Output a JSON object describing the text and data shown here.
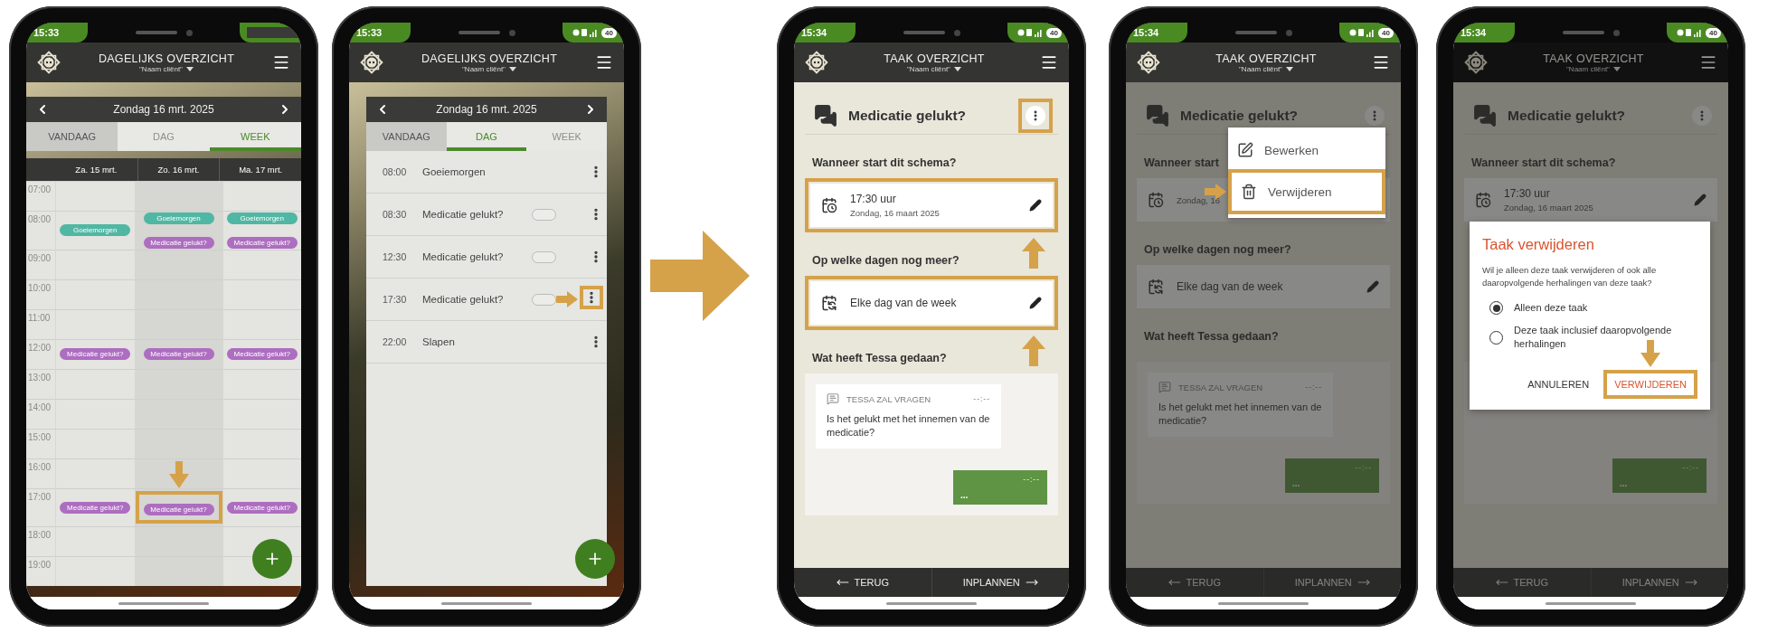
{
  "steps": [
    {
      "kind": "week",
      "status": {
        "time": "15:33",
        "redacted": true
      },
      "header": {
        "title": "DAGELIJKS OVERZICHT",
        "subtitle": "\"Naam cliënt\""
      },
      "date": "Zondag 16 mrt. 2025",
      "tabs": [
        {
          "label": "VANDAAG",
          "kind": "button",
          "selected": false
        },
        {
          "label": "DAG",
          "kind": "tab",
          "selected": false
        },
        {
          "label": "WEEK",
          "kind": "tab",
          "selected": true
        }
      ],
      "days": [
        {
          "label": "Za. 15 mrt.",
          "today": false
        },
        {
          "label": "Zo. 16 mrt.",
          "today": true
        },
        {
          "label": "Ma. 17 mrt.",
          "today": false
        }
      ],
      "hours": [
        {
          "label": "07:00"
        },
        {
          "label": "08:00",
          "cells": [
            {
              "events": [
                {
                  "label": "Goeiemorgen",
                  "color": "#4fb7a3"
                }
              ]
            },
            {
              "events": [
                {
                  "label": "Goeiemorgen",
                  "color": "#4fb7a3"
                },
                {
                  "label": "Medicatie gelukt?",
                  "color": "#ad6dc0"
                }
              ]
            },
            {
              "events": [
                {
                  "label": "Goeiemorgen",
                  "color": "#4fb7a3"
                },
                {
                  "label": "Medicatie gelukt?",
                  "color": "#ad6dc0"
                }
              ]
            }
          ]
        },
        {
          "label": "09:00"
        },
        {
          "label": "10:00"
        },
        {
          "label": "11:00"
        },
        {
          "label": "12:00",
          "cells": [
            {
              "events": [
                {
                  "label": "Medicatie gelukt?",
                  "color": "#ad6dc0"
                }
              ]
            },
            {
              "events": [
                {
                  "label": "Medicatie gelukt?",
                  "color": "#ad6dc0"
                }
              ]
            },
            {
              "events": [
                {
                  "label": "Medicatie gelukt?",
                  "color": "#ad6dc0"
                }
              ]
            }
          ]
        },
        {
          "label": "13:00"
        },
        {
          "label": "14:00"
        },
        {
          "label": "15:00"
        },
        {
          "label": "16:00"
        },
        {
          "label": "17:00",
          "cells": [
            {
              "events": [
                {
                  "label": "Medicatie gelukt?",
                  "color": "#ad6dc0"
                }
              ]
            },
            {
              "events": [
                {
                  "label": "Medicatie gelukt?",
                  "color": "#ad6dc0",
                  "highlight": {
                    "kind": "arrow-down"
                  }
                }
              ]
            },
            {
              "events": [
                {
                  "label": "Medicatie gelukt?",
                  "color": "#ad6dc0"
                }
              ]
            }
          ]
        },
        {
          "label": "18:00"
        },
        {
          "label": "19:00"
        }
      ]
    },
    {
      "kind": "day",
      "status": {
        "time": "15:33",
        "battery": "40"
      },
      "header": {
        "title": "DAGELIJKS OVERZICHT",
        "subtitle": "\"Naam cliënt\""
      },
      "date": "Zondag 16 mrt. 2025",
      "tabs": [
        {
          "label": "VANDAAG",
          "kind": "button",
          "selected": false
        },
        {
          "label": "DAG",
          "kind": "tab",
          "selected": true
        },
        {
          "label": "WEEK",
          "kind": "tab",
          "selected": false
        }
      ],
      "tasks": [
        {
          "time": "08:00",
          "label": "Goeiemorgen"
        },
        {
          "time": "08:30",
          "label": "Medicatie gelukt?",
          "toggle": {
            "on": false
          }
        },
        {
          "time": "12:30",
          "label": "Medicatie gelukt?",
          "toggle": {
            "on": false
          }
        },
        {
          "time": "17:30",
          "label": "Medicatie gelukt?",
          "toggle": {
            "on": false
          },
          "more_highlight": {
            "kind": "arrow-right"
          }
        },
        {
          "time": "22:00",
          "label": "Slapen"
        }
      ]
    },
    {
      "kind": "detail",
      "status": {
        "time": "15:34",
        "battery": "40"
      },
      "header": {
        "title": "TAAK OVERZICHT",
        "subtitle": "\"Naam cliënt\""
      },
      "task": {
        "title": "Medicatie gelukt?",
        "more_highlight": {
          "kind": "box"
        }
      },
      "sections": [
        {
          "heading": "Wanneer start dit schema?",
          "card": {
            "kind": "datetime",
            "line1": "17:30 uur",
            "line2": "Zondag, 16 maart 2025",
            "editable": true,
            "highlight": {
              "kind": "arrow-up"
            }
          }
        },
        {
          "heading": "Op welke dagen nog meer?",
          "card": {
            "kind": "repeat",
            "line1": "Elke dag van de week",
            "editable": true,
            "highlight": {
              "kind": "arrow-up"
            }
          }
        }
      ],
      "conversation": {
        "heading": "Wat heeft Tessa gedaan?",
        "question": {
          "sender": "TESSA ZAL VRAGEN",
          "time": "--:--",
          "text": "Is het gelukt met het innemen van de medicatie?"
        },
        "reply": {
          "text": "...",
          "time": "--:--"
        }
      },
      "footer": [
        {
          "label": "TERUG",
          "kind": "back"
        },
        {
          "label": "INPLANNEN",
          "kind": "next"
        }
      ]
    },
    {
      "kind": "detail",
      "dimmed": true,
      "status": {
        "time": "15:34",
        "battery": "40"
      },
      "header": {
        "title": "TAAK OVERZICHT",
        "subtitle": "\"Naam cliënt\""
      },
      "task": {
        "title": "Medicatie gelukt?"
      },
      "sections": [
        {
          "heading": "Wanneer start",
          "card": {
            "kind": "datetime",
            "line2": "Zondag, 16"
          }
        },
        {
          "heading": "Op welke dagen nog meer?",
          "card": {
            "kind": "repeat",
            "line1": "Elke dag van de week",
            "editable": true
          }
        }
      ],
      "conversation": {
        "heading": "Wat heeft Tessa gedaan?",
        "question": {
          "sender": "TESSA ZAL VRAGEN",
          "time": "--:--",
          "text": "Is het gelukt met het innemen van de medicatie?"
        },
        "reply": {
          "text": "...",
          "time": "--:--"
        }
      },
      "footer": [
        {
          "label": "TERUG",
          "kind": "back"
        },
        {
          "label": "INPLANNEN",
          "kind": "next"
        }
      ],
      "menu": {
        "items": [
          {
            "kind": "edit",
            "label": "Bewerken"
          },
          {
            "kind": "delete",
            "label": "Verwijderen",
            "highlight": {
              "kind": "arrow-right"
            }
          }
        ]
      }
    },
    {
      "kind": "detail",
      "dimmed": true,
      "status": {
        "time": "15:34",
        "battery": "40"
      },
      "header": {
        "title": "TAAK OVERZICHT",
        "subtitle": "\"Naam cliënt\"",
        "dimmed": true
      },
      "task": {
        "title": "Medicatie gelukt?"
      },
      "sections": [
        {
          "heading": "Wanneer start dit schema?",
          "card": {
            "kind": "datetime",
            "line1": "17:30 uur",
            "line2": "Zondag, 16 maart 2025",
            "editable": true
          }
        }
      ],
      "conversation": {
        "reply": {
          "text": "...",
          "time": "--:--"
        }
      },
      "footer": [
        {
          "label": "TERUG",
          "kind": "back"
        },
        {
          "label": "INPLANNEN",
          "kind": "next"
        }
      ],
      "dialog": {
        "title": "Taak verwijderen",
        "text": "Wil je alleen deze taak verwijderen of ook alle daaropvolgende herhalingen van deze taak?",
        "options": [
          {
            "label": "Alleen deze taak",
            "selected": true
          },
          {
            "label": "Deze taak inclusief daaropvolgende herhalingen",
            "selected": false
          }
        ],
        "actions": [
          {
            "label": "ANNULEREN",
            "kind": "cancel"
          },
          {
            "label": "VERWIJDEREN",
            "kind": "confirm",
            "highlight": {
              "kind": "arrow-down"
            }
          }
        ]
      }
    }
  ]
}
